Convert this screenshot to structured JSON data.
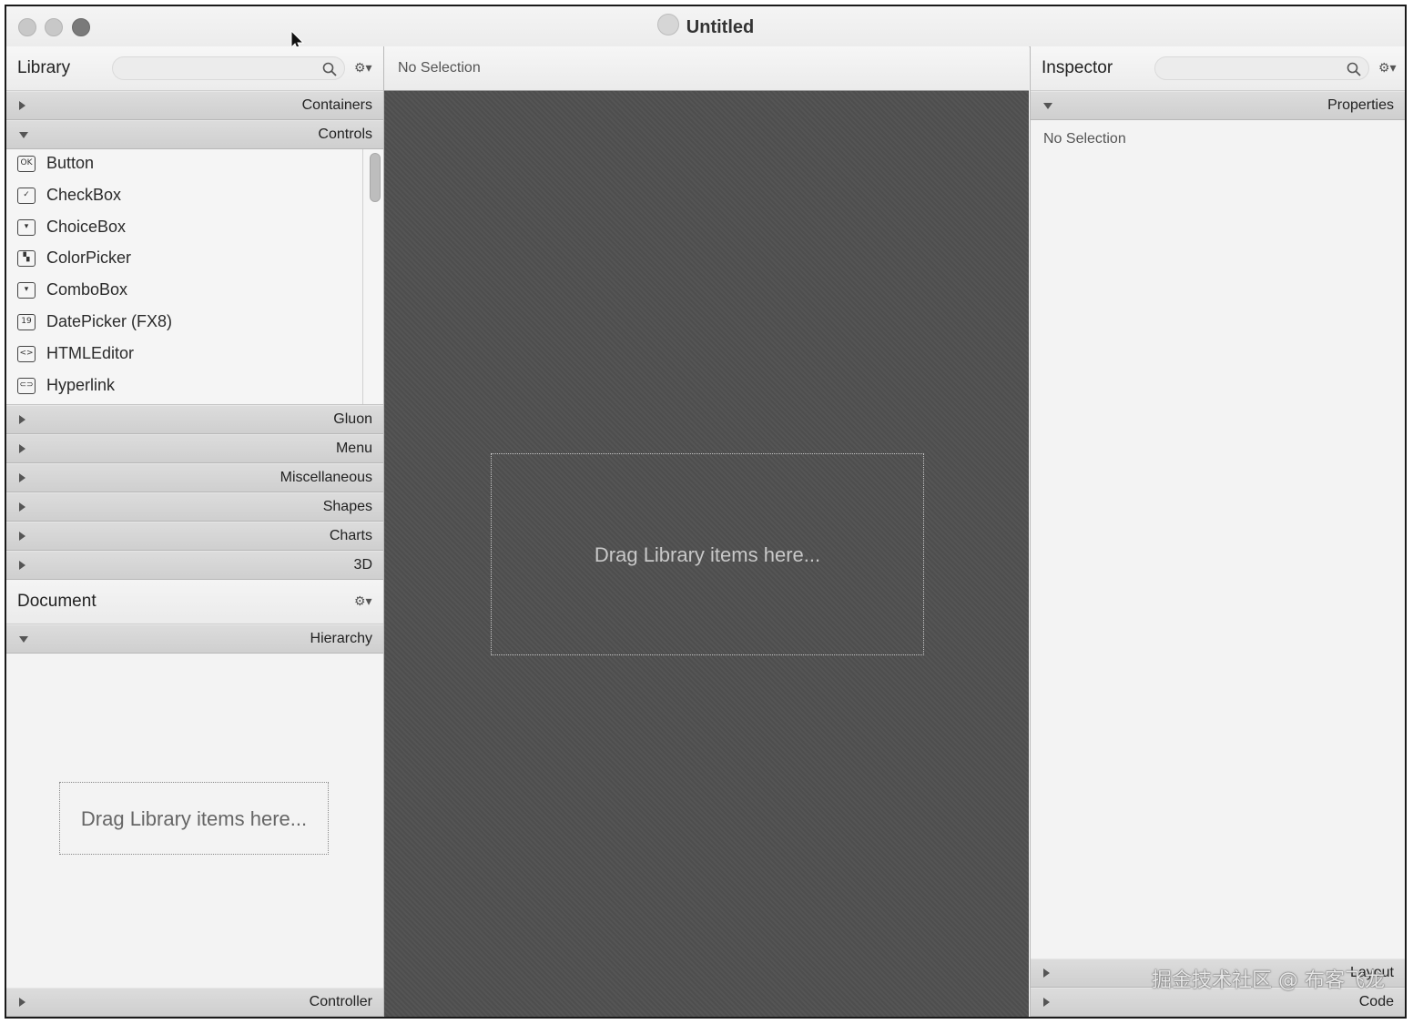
{
  "window": {
    "title": "Untitled"
  },
  "library": {
    "title": "Library",
    "search_placeholder": "",
    "sections_top": [
      {
        "label": "Containers",
        "expanded": false
      },
      {
        "label": "Controls",
        "expanded": true
      }
    ],
    "controls": [
      {
        "label": "Button",
        "icon": "ok-button-icon",
        "glyph": "OK"
      },
      {
        "label": "CheckBox",
        "icon": "checkbox-icon",
        "glyph": "✓"
      },
      {
        "label": "ChoiceBox",
        "icon": "choicebox-icon",
        "glyph": "▾"
      },
      {
        "label": "ColorPicker",
        "icon": "colorpicker-icon",
        "glyph": "▚"
      },
      {
        "label": "ComboBox",
        "icon": "combobox-icon",
        "glyph": "▾"
      },
      {
        "label": "DatePicker  (FX8)",
        "icon": "calendar-icon",
        "glyph": "19"
      },
      {
        "label": "HTMLEditor",
        "icon": "html-editor-icon",
        "glyph": "<>"
      },
      {
        "label": "Hyperlink",
        "icon": "link-icon",
        "glyph": "⊂⊃"
      }
    ],
    "sections_bottom": [
      {
        "label": "Gluon"
      },
      {
        "label": "Menu"
      },
      {
        "label": "Miscellaneous"
      },
      {
        "label": "Shapes"
      },
      {
        "label": "Charts"
      },
      {
        "label": "3D"
      }
    ]
  },
  "document": {
    "title": "Document",
    "hierarchy_label": "Hierarchy",
    "drop_hint": "Drag Library items here...",
    "controller_label": "Controller"
  },
  "center": {
    "selection_text": "No Selection",
    "drop_hint": "Drag Library items here..."
  },
  "inspector": {
    "title": "Inspector",
    "search_placeholder": "",
    "properties_label": "Properties",
    "selection_text": "No Selection",
    "layout_label": "Layout",
    "code_label": "Code"
  },
  "watermark": "掘金技术社区 @ 布客飞龙"
}
